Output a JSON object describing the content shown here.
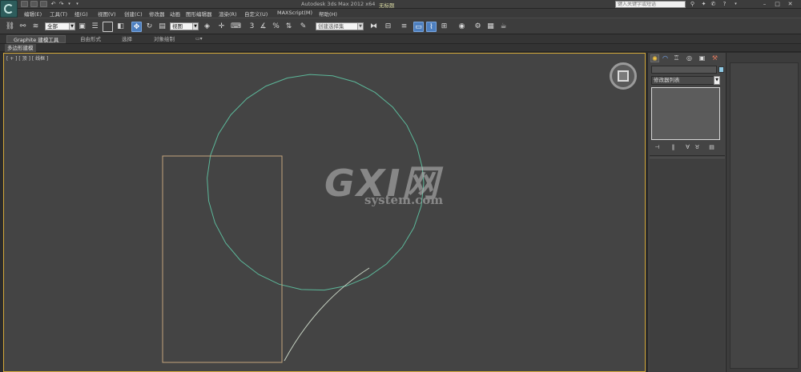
{
  "window": {
    "title": "Autodesk 3ds Max  2012 x64",
    "file_name": "无标题",
    "search_placeholder": "键入关键字或短语"
  },
  "menu": {
    "items": [
      "编辑(E)",
      "工具(T)",
      "组(G)",
      "视图(V)",
      "创建(C)",
      "修改器",
      "动画",
      "图形编辑器",
      "渲染(R)",
      "自定义(U)",
      "MAXScript(M)",
      "帮助(H)"
    ]
  },
  "toolbar": {
    "selection_filter": "全部",
    "ref_coord": "视图",
    "named_selection": "创建选择集"
  },
  "ribbon": {
    "tabs": [
      "Graphite 建模工具",
      "自由形式",
      "选择",
      "对象绘制"
    ],
    "active_tab": 0,
    "subtab": "多边形建模"
  },
  "viewport": {
    "label": "[ + ] [ 顶 ] [ 线框 ]",
    "border_color": "#d4a93a",
    "background": "#444444",
    "shapes": [
      {
        "type": "circle",
        "color": "#5cb89a"
      },
      {
        "type": "rectangle",
        "color": "#c4a47c"
      },
      {
        "type": "line",
        "color": "#c8d4c4"
      }
    ],
    "watermark_big": "GXI网",
    "watermark_small": "system.com"
  },
  "command_panel": {
    "tabs": [
      "create-icon",
      "modify-icon",
      "hierarchy-icon",
      "motion-icon",
      "display-icon",
      "utilities-icon"
    ],
    "active_tab": 0,
    "modifier_list": "修改器列表",
    "object_color": "#8ec9e4"
  }
}
